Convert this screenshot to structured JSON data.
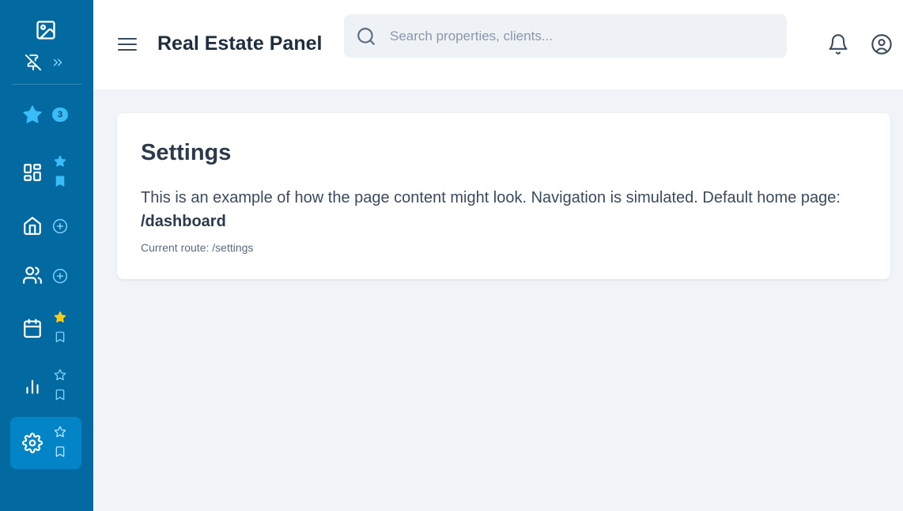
{
  "colors": {
    "sidebar_bg": "#0369a1",
    "sidebar_active": "#0284c7",
    "accent": "#38bdf8",
    "favorite_gold": "#facc15",
    "content_bg": "#f0f4f8"
  },
  "sidebar": {
    "logo_icon": "image-icon",
    "pin_icon": "pin-off-icon",
    "expand_icon": "chevrons-right-icon",
    "items": [
      {
        "id": "favorites",
        "icon": "star-icon",
        "badge": "3"
      },
      {
        "id": "dashboard",
        "icon": "layout-grid-icon",
        "favorite": true,
        "bookmarked": true
      },
      {
        "id": "properties",
        "icon": "home-icon",
        "action": "plus-circle-icon"
      },
      {
        "id": "clients",
        "icon": "users-icon",
        "action": "plus-circle-icon"
      },
      {
        "id": "calendar",
        "icon": "calendar-icon",
        "favorite": true,
        "favorite_color": "gold",
        "bookmarked": false
      },
      {
        "id": "analytics",
        "icon": "bar-chart-icon",
        "favorite": false,
        "bookmarked": false
      },
      {
        "id": "settings",
        "icon": "settings-icon",
        "favorite": false,
        "bookmarked": false,
        "active": true
      }
    ]
  },
  "header": {
    "menu_icon": "menu-icon",
    "title": "Real Estate Panel",
    "search": {
      "placeholder": "Search properties, clients...",
      "value": ""
    },
    "notifications_icon": "bell-icon",
    "profile_icon": "user-circle-icon"
  },
  "content": {
    "title": "Settings",
    "description": "This is an example of how the page content might look. Navigation is simulated. Default home page:",
    "home_page": "/dashboard",
    "route_label": "Current route: /settings"
  }
}
